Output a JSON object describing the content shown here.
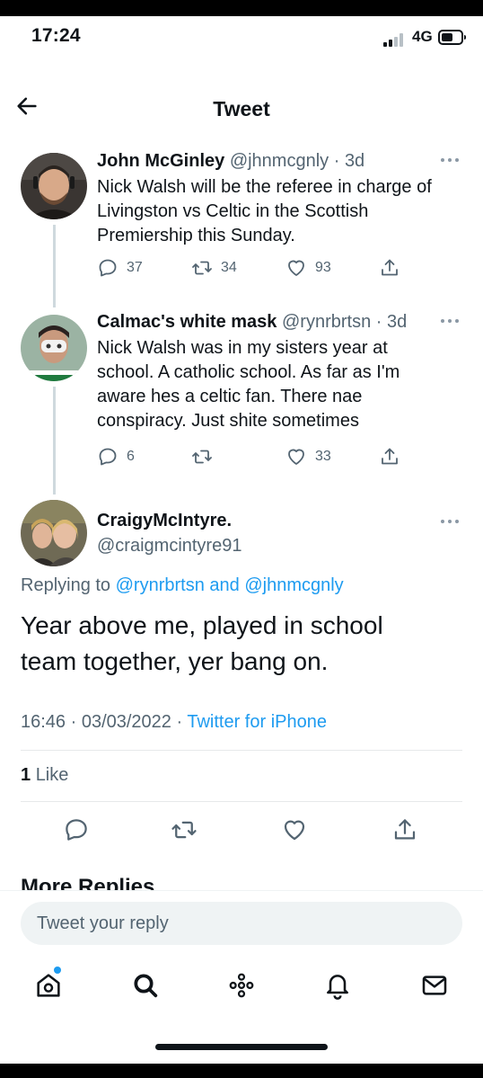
{
  "status_bar": {
    "time": "17:24",
    "network": "4G"
  },
  "header": {
    "title": "Tweet"
  },
  "thread": [
    {
      "name": "John McGinley",
      "handle": "@jhnmcgnly",
      "time": "3d",
      "text_lines": [
        "Nick Walsh will be the referee in charge of",
        "Livingston vs Celtic in the Scottish",
        "Premiership this Sunday."
      ],
      "replies": "37",
      "retweets": "34",
      "likes": "93"
    },
    {
      "name": "Calmac's white mask",
      "handle": "@rynrbrtsn",
      "time": "3d",
      "text_lines": [
        "Nick Walsh was in my sisters year at",
        "school. A catholic school. As far as I'm",
        "aware hes a celtic fan. There nae",
        "conspiracy. Just shite sometimes"
      ],
      "replies": "6",
      "retweets": "",
      "likes": "33"
    }
  ],
  "main_tweet": {
    "name": "CraigyMcIntyre.",
    "handle": "@craigmcintyre91",
    "replying_prefix": "Replying to",
    "replying_user1": "@rynrbrtsn",
    "replying_and": "and",
    "replying_user2": "@jhnmcgnly",
    "text_lines": [
      "Year above me, played in school",
      "team together, yer bang on."
    ],
    "timestamp": "16:46 · 03/03/2022 ·",
    "source": "Twitter for iPhone",
    "like_count": "1",
    "like_label": "Like"
  },
  "more_replies": "More Replies",
  "composer": {
    "placeholder": "Tweet your reply"
  },
  "bottom_nav": [
    "home-icon",
    "search-icon",
    "spaces-icon",
    "notifications-icon",
    "messages-icon"
  ],
  "colors": {
    "accent": "#1d9bf0",
    "text": "#0f1419",
    "muted": "#536471"
  }
}
